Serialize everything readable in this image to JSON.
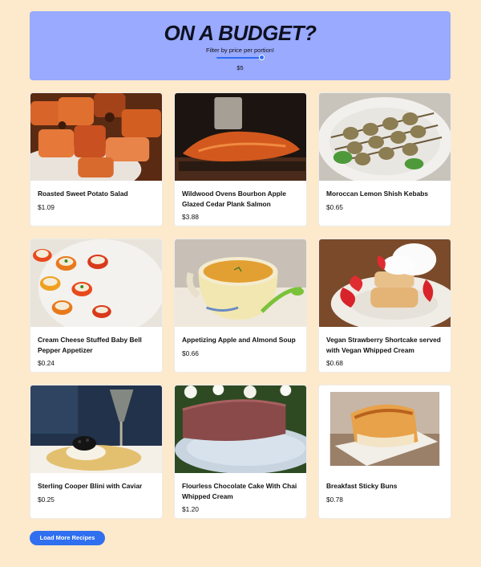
{
  "header": {
    "title": "ON A BUDGET?",
    "filter_label": "Filter by price per portion!",
    "slider_value_fraction": 1.0,
    "price_value": "$5"
  },
  "recipes": [
    {
      "title": "Roasted Sweet Potato Salad",
      "price": "$1.09"
    },
    {
      "title": "Wildwood Ovens Bourbon Apple Glazed Cedar Plank Salmon",
      "price": "$3.88"
    },
    {
      "title": "Moroccan Lemon Shish Kebabs",
      "price": "$0.65"
    },
    {
      "title": "Cream Cheese Stuffed Baby Bell Pepper Appetizer",
      "price": "$0.24"
    },
    {
      "title": "Appetizing Apple and Almond Soup",
      "price": "$0.66"
    },
    {
      "title": "Vegan Strawberry Shortcake served with Vegan Whipped Cream",
      "price": "$0.68"
    },
    {
      "title": "Sterling Cooper Blini with Caviar",
      "price": "$0.25"
    },
    {
      "title": "Flourless Chocolate Cake With Chai Whipped Cream",
      "price": "$1.20"
    },
    {
      "title": "Breakfast Sticky Buns",
      "price": "$0.78"
    }
  ],
  "load_more_label": "Load More Recipes",
  "colors": {
    "background": "#fde9cb",
    "header_bg": "#99aaff",
    "accent": "#2f6ff0"
  }
}
